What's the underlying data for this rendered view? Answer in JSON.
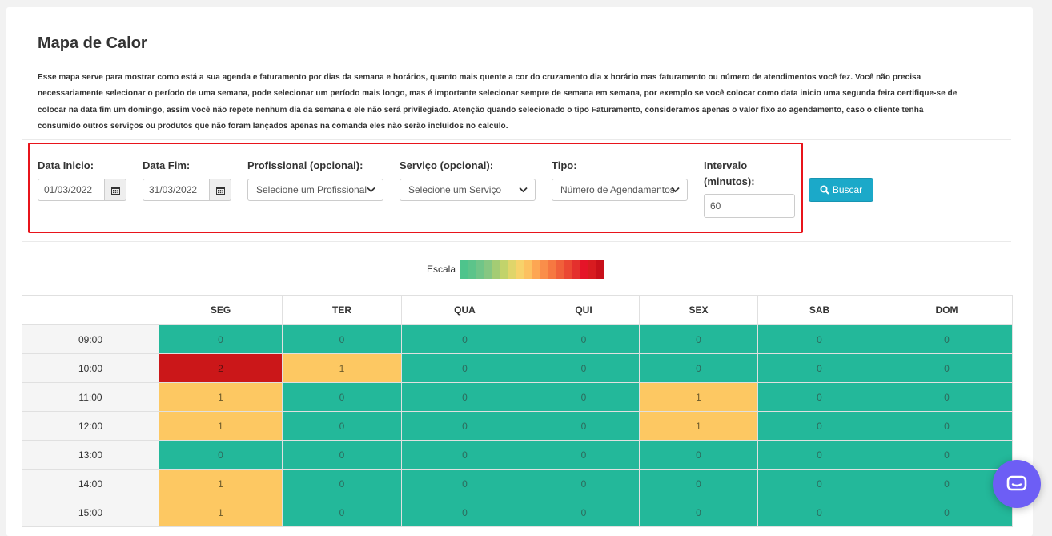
{
  "page": {
    "title": "Mapa de Calor",
    "description": [
      "Esse mapa serve para mostrar como está a sua agenda e faturamento por dias da semana e horários, quanto mais quente a cor do cruzamento dia x horário mas faturamento ou número de atendimentos você fez. Você não precisa",
      "necessariamente selecionar o período de uma semana, pode selecionar um período mais longo, mas é importante selecionar sempre de semana em semana, por exemplo se você colocar como data inicio uma segunda feira certifique-se de",
      "colocar na data fim um domingo, assim você não repete nenhum dia da semana e ele não será privilegiado. Atenção quando selecionado o tipo Faturamento, consideramos apenas o valor fixo ao agendamento, caso o cliente tenha",
      "consumido outros serviços ou produtos que não foram lançados apenas na comanda eles não serão incluidos no calculo."
    ]
  },
  "filters": {
    "start_label": "Data Inicio:",
    "start_value": "01/03/2022",
    "end_label": "Data Fim:",
    "end_value": "31/03/2022",
    "professional_label": "Profissional (opcional):",
    "professional_value": "Selecione um Profissional",
    "service_label": "Serviço (opcional):",
    "service_value": "Selecione um Serviço",
    "type_label": "Tipo:",
    "type_value": "Número de Agendamentos",
    "interval_label_1": "Intervalo",
    "interval_label_2": "(minutos):",
    "interval_value": "60",
    "search_button": "Buscar"
  },
  "scale": {
    "label": "Escala",
    "colors": [
      "#4ec48c",
      "#5cc48a",
      "#70c588",
      "#86c782",
      "#a4cc74",
      "#c2d36b",
      "#e0d56a",
      "#f7d26a",
      "#fcc160",
      "#fda653",
      "#fa8e4a",
      "#f67841",
      "#f0603a",
      "#eb4833",
      "#e4302d",
      "#e51428",
      "#d81b20",
      "#c8101a"
    ]
  },
  "heatmap": {
    "days": [
      "SEG",
      "TER",
      "QUA",
      "QUI",
      "SEX",
      "SAB",
      "DOM"
    ],
    "rows": [
      {
        "time": "09:00",
        "values": [
          0,
          0,
          0,
          0,
          0,
          0,
          0
        ]
      },
      {
        "time": "10:00",
        "values": [
          2,
          1,
          0,
          0,
          0,
          0,
          0
        ]
      },
      {
        "time": "11:00",
        "values": [
          1,
          0,
          0,
          0,
          1,
          0,
          0
        ]
      },
      {
        "time": "12:00",
        "values": [
          1,
          0,
          0,
          0,
          1,
          0,
          0
        ]
      },
      {
        "time": "13:00",
        "values": [
          0,
          0,
          0,
          0,
          0,
          0,
          0
        ]
      },
      {
        "time": "14:00",
        "values": [
          1,
          0,
          0,
          0,
          0,
          0,
          0
        ]
      },
      {
        "time": "15:00",
        "values": [
          1,
          0,
          0,
          0,
          0,
          0,
          0
        ]
      }
    ]
  },
  "colors": {
    "zero": "#23b89a",
    "one": "#fdc862",
    "two": "#cb1719",
    "button": "#1ba9c9",
    "highlight_box": "#e8141b",
    "chat": "#6d5ef5"
  }
}
